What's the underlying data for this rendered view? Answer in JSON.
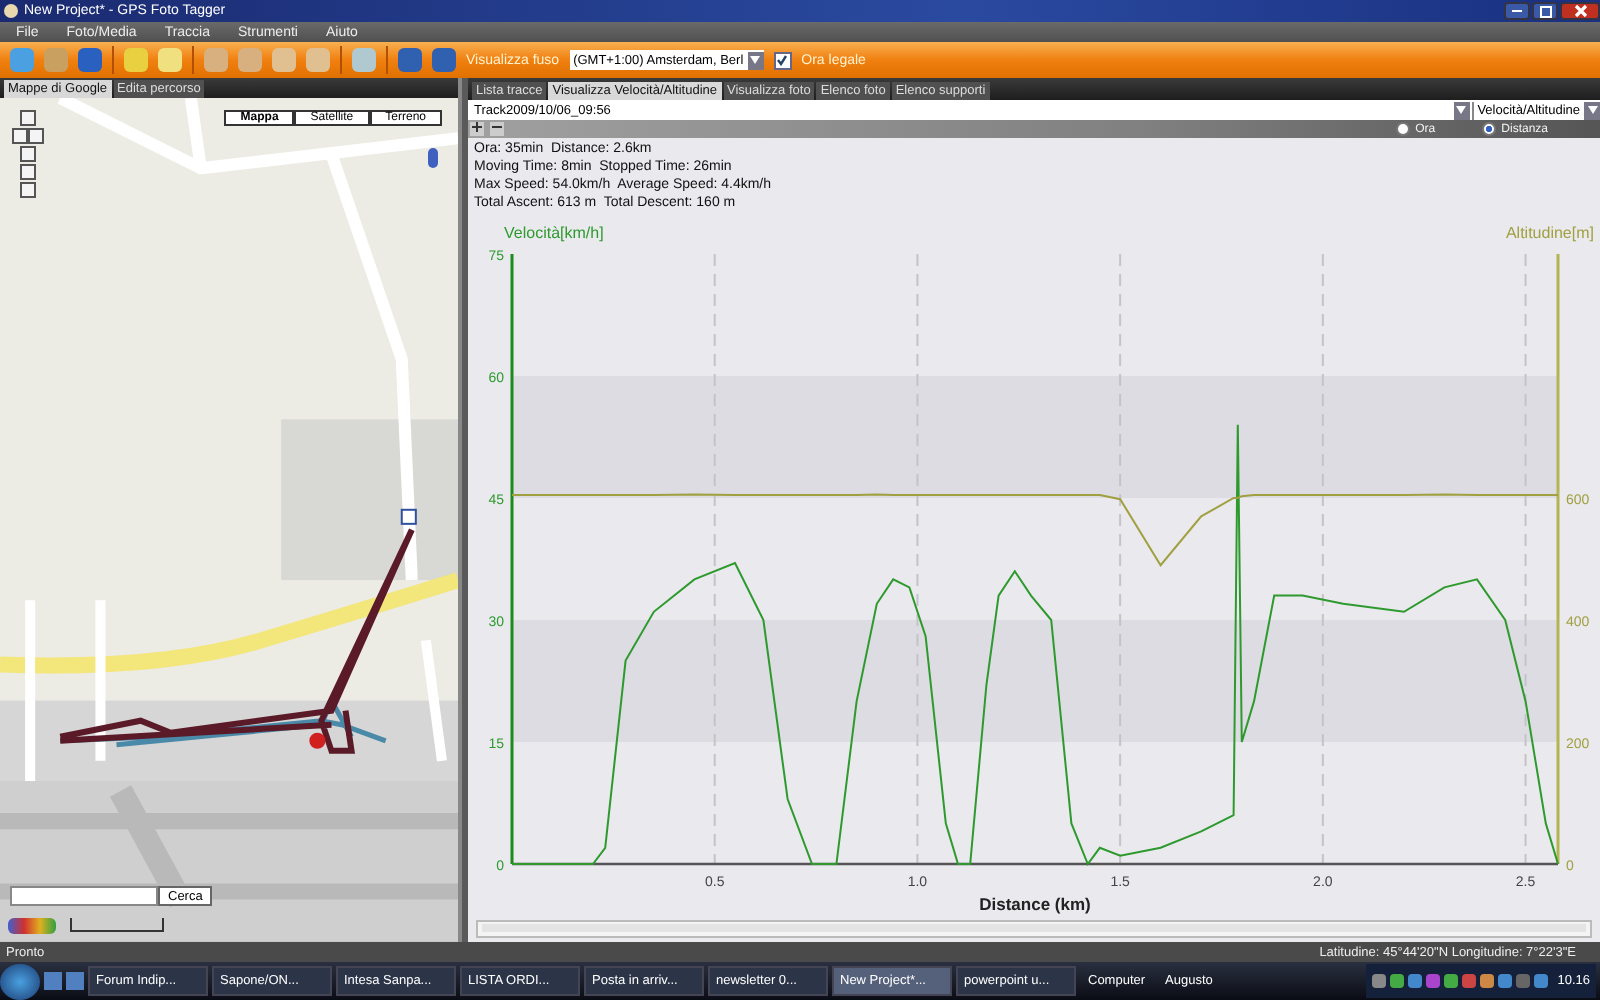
{
  "window": {
    "title": "New Project* - GPS Foto Tagger"
  },
  "menu": [
    "File",
    "Foto/Media",
    "Traccia",
    "Strumenti",
    "Aiuto"
  ],
  "toolbar": {
    "timezone_label": "Visualizza fuso",
    "timezone": "(GMT+1:00) Amsterdam, Berl",
    "dst": {
      "label": "Ora legale",
      "checked": true
    }
  },
  "left_tabs": [
    {
      "label": "Mappe di Google",
      "selected": true
    },
    {
      "label": "Edita percorso",
      "selected": false
    }
  ],
  "map": {
    "map_types": [
      {
        "label": "Mappa",
        "selected": true
      },
      {
        "label": "Satellite",
        "selected": false
      },
      {
        "label": "Terreno",
        "selected": false
      }
    ],
    "search_button": "Cerca"
  },
  "right_tabs": [
    {
      "label": "Lista tracce",
      "selected": false
    },
    {
      "label": "Visualizza Velocità/Altitudine",
      "selected": true
    },
    {
      "label": "Visualizza foto",
      "selected": false
    },
    {
      "label": "Elenco foto",
      "selected": false
    },
    {
      "label": "Elenco supporti",
      "selected": false
    }
  ],
  "track": "Track2009/10/06_09:56",
  "view": "Velocità/Altitudine",
  "axis_mode": [
    {
      "label": "Ora",
      "selected": false
    },
    {
      "label": "Distanza",
      "selected": true
    }
  ],
  "stats": [
    "Ora: 35min  Distance: 2.6km",
    "Moving Time: 8min  Stopped Time: 26min",
    "Max Speed: 54.0km/h  Average Speed: 4.4km/h",
    "Total Ascent: 613 m  Total Descent: 160 m"
  ],
  "chart_data": {
    "type": "line",
    "xlabel": "Distance (km)",
    "grid": true,
    "xlim": [
      0,
      2.58
    ],
    "ylim": [
      0,
      75
    ],
    "y2lim": [
      0,
      1000
    ],
    "xticks": [
      0.5,
      {
        "value": 1,
        "label": "1.0"
      },
      1.5,
      {
        "value": 2,
        "label": "2.0"
      },
      2.5
    ],
    "yticks": [
      0,
      15,
      30,
      45,
      60,
      75
    ],
    "y2ticks": [
      0,
      200,
      400,
      600
    ],
    "x": [
      0,
      0.2,
      0.23,
      0.28,
      0.35,
      0.45,
      0.55,
      0.62,
      0.68,
      0.74,
      0.8,
      0.85,
      0.9,
      0.94,
      0.98,
      1.02,
      1.07,
      1.1,
      1.13,
      1.17,
      1.2,
      1.24,
      1.28,
      1.33,
      1.38,
      1.42,
      1.45,
      1.5,
      1.6,
      1.7,
      1.78,
      1.79,
      1.8,
      1.83,
      1.88,
      1.95,
      2.05,
      2.2,
      2.3,
      2.38,
      2.45,
      2.5,
      2.55,
      2.58
    ],
    "series": [
      {
        "name": "Velocità[km/h]",
        "color": "#2e9a2e",
        "values": [
          0,
          0,
          2,
          25,
          31,
          35,
          37,
          30,
          8,
          0,
          0,
          20,
          32,
          35,
          34,
          28,
          5,
          0,
          0,
          22,
          33,
          36,
          33,
          30,
          5,
          0,
          2,
          1,
          2,
          4,
          6,
          54,
          15,
          20,
          33,
          33,
          32,
          31,
          34,
          35,
          30,
          20,
          5,
          0
        ]
      },
      {
        "name": "Altitudine[m]",
        "color": "#a0a040",
        "axis": "y2",
        "values": [
          605,
          605,
          605,
          605,
          605,
          606,
          605,
          605,
          605,
          605,
          605,
          605,
          606,
          605,
          605,
          605,
          605,
          605,
          605,
          605,
          605,
          605,
          605,
          605,
          605,
          605,
          605,
          598,
          490,
          570,
          600,
          600,
          603,
          605,
          605,
          605,
          605,
          605,
          606,
          605,
          605,
          605,
          605,
          605
        ]
      }
    ]
  },
  "status": {
    "left": "Pronto",
    "right": "Latitudine: 45°44'20\"N  Longitudine: 7°22'3\"E"
  },
  "taskbar": {
    "items": [
      {
        "label": "Forum Indip...",
        "selected": false
      },
      {
        "label": "Sapone/ON...",
        "selected": false
      },
      {
        "label": "Intesa Sanpa...",
        "selected": false
      },
      {
        "label": "LISTA ORDI...",
        "selected": false
      },
      {
        "label": "Posta in arriv...",
        "selected": false
      },
      {
        "label": "newsletter 0...",
        "selected": false
      },
      {
        "label": "New Project*...",
        "selected": true
      },
      {
        "label": "powerpoint u...",
        "selected": false
      }
    ],
    "toolbars": [
      "Computer",
      "Augusto"
    ],
    "clock": "10.16"
  }
}
